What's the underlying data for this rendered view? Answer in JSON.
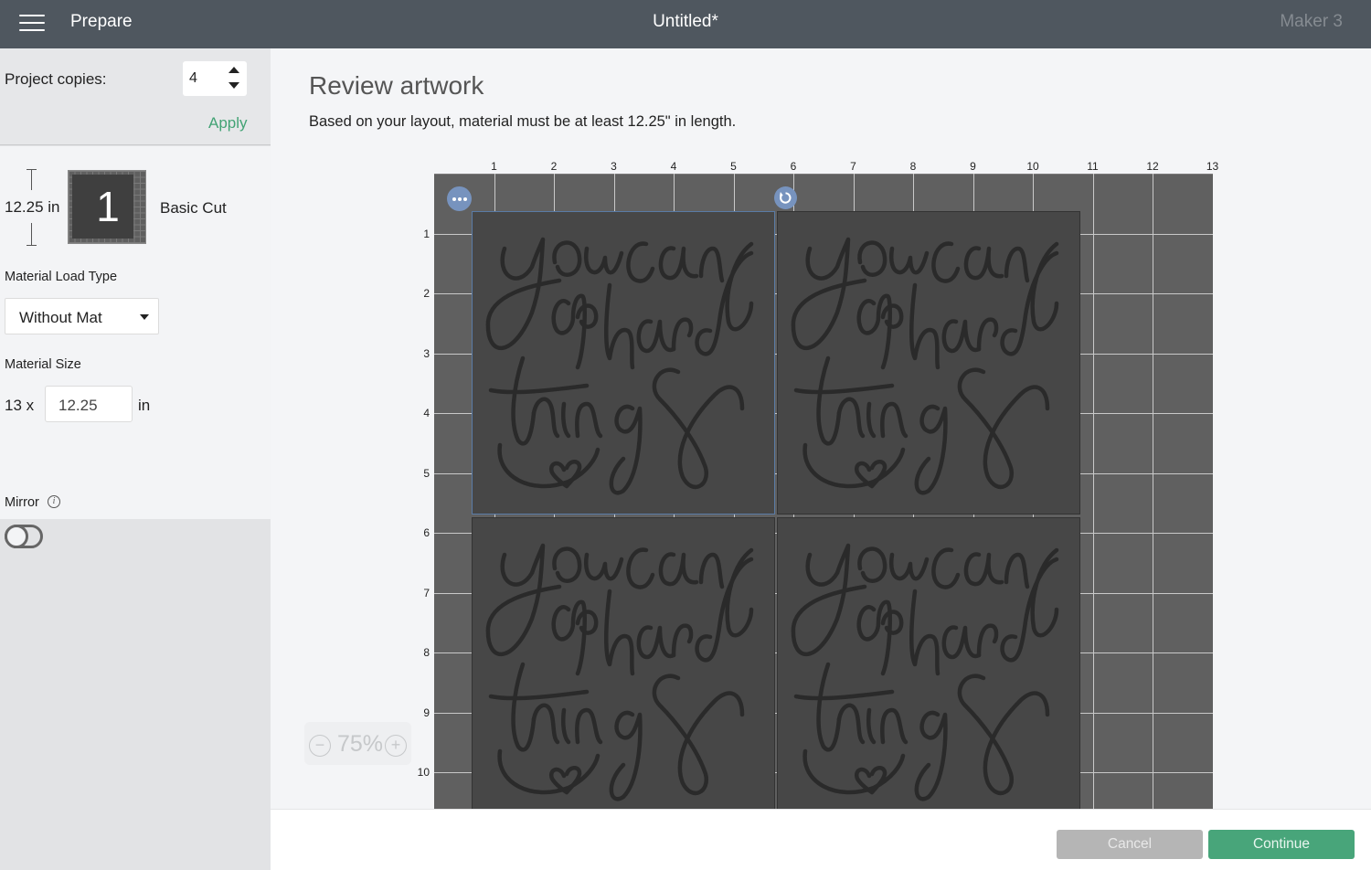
{
  "header": {
    "menu_icon": "hamburger-icon",
    "section": "Prepare",
    "document_title": "Untitled*",
    "machine": "Maker 3"
  },
  "sidebar": {
    "project_copies_label": "Project copies:",
    "project_copies_value": "4",
    "apply_label": "Apply",
    "mat": {
      "length": "12.25 in",
      "number": "1",
      "operation": "Basic Cut"
    },
    "material_load_type_label": "Material Load Type",
    "material_load_type_value": "Without Mat",
    "material_size_label": "Material Size",
    "material_width": "13 x",
    "material_length": "12.25",
    "material_unit": "in",
    "mirror_label": "Mirror",
    "mirror_info_icon": "i",
    "mirror_on": false
  },
  "main": {
    "title": "Review artwork",
    "subtitle": "Based on your layout, material must be at least 12.25\" in length.",
    "ruler_x": [
      "1",
      "2",
      "3",
      "4",
      "5",
      "6",
      "7",
      "8",
      "9",
      "10",
      "11",
      "12",
      "13"
    ],
    "ruler_y": [
      "1",
      "2",
      "3",
      "4",
      "5",
      "6",
      "7",
      "8",
      "9",
      "10"
    ],
    "artwork_text": "you can do hard things",
    "artwork_copies": 4,
    "zoom": {
      "minus": "−",
      "value": "75%",
      "plus": "+"
    }
  },
  "footer": {
    "cancel_label": "Cancel",
    "continue_label": "Continue"
  },
  "colors": {
    "header_bg": "#4f575f",
    "accent_green": "#48a57a",
    "apply_green": "#43a375",
    "mat_bg": "#606060",
    "artwork_bg": "#474747",
    "handle_blue": "#7793be"
  }
}
